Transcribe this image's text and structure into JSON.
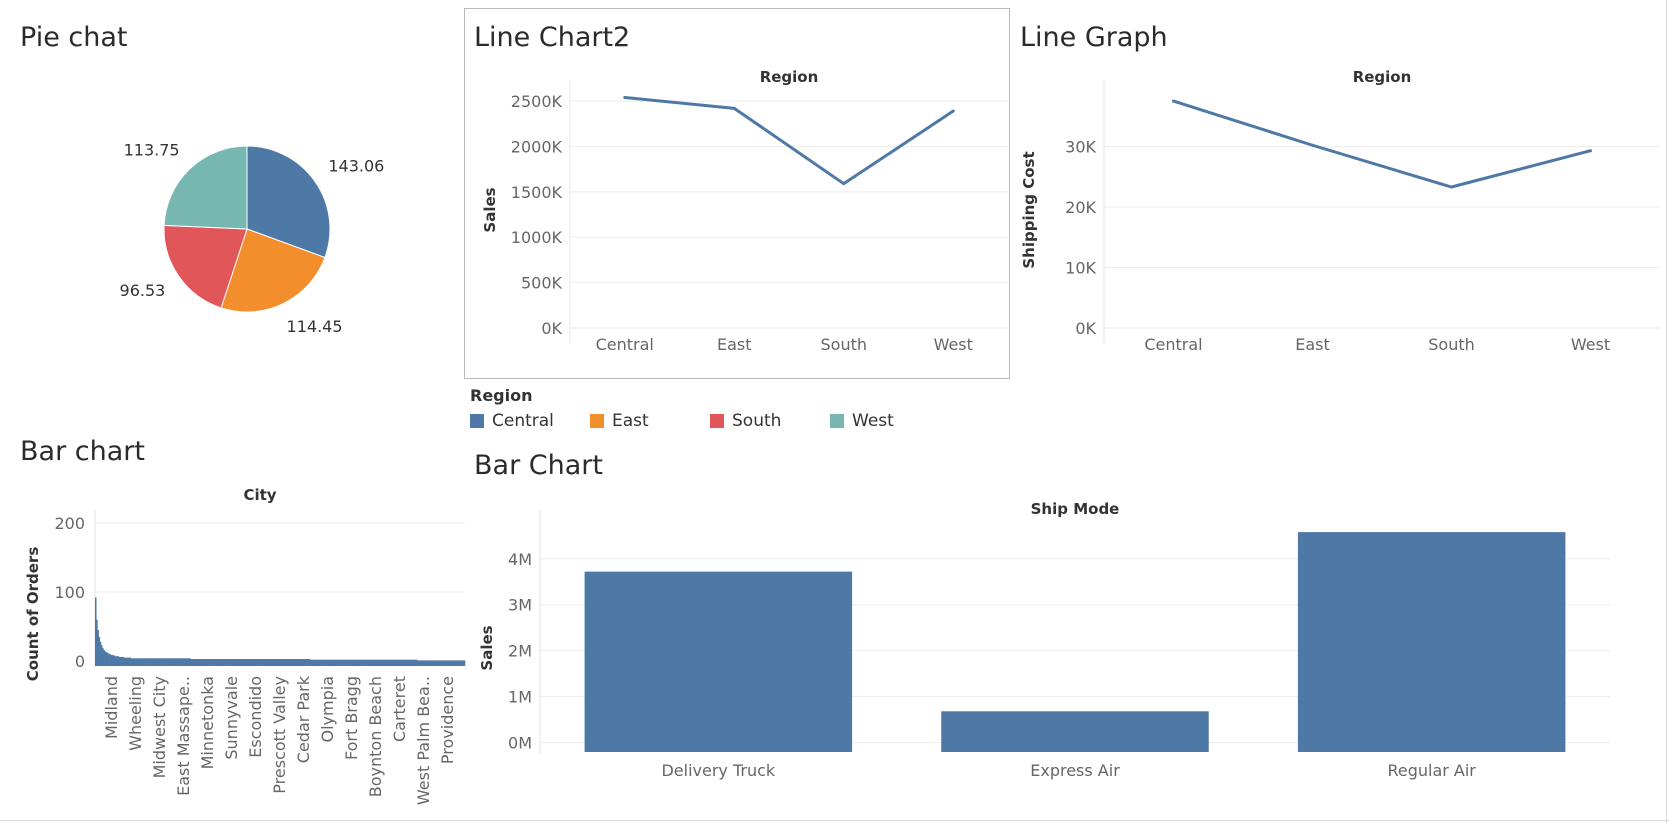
{
  "titles": {
    "pie": "Pie chat",
    "line1": "Line Chart2",
    "line2": "Line Graph",
    "bar1": "Bar chart",
    "bar2": "Bar Chart"
  },
  "colors": {
    "blue": "#4e79a7",
    "orange": "#f28e2b",
    "red": "#e15759",
    "teal": "#76b7b2"
  },
  "legend": {
    "title": "Region",
    "items": [
      {
        "label": "Central",
        "color": "#4e79a7"
      },
      {
        "label": "East",
        "color": "#f28e2b"
      },
      {
        "label": "South",
        "color": "#e15759"
      },
      {
        "label": "West",
        "color": "#76b7b2"
      }
    ]
  },
  "chart_data": [
    {
      "type": "pie",
      "slices": [
        {
          "region": "Central",
          "value": 143.06,
          "label": "143.06",
          "color": "#4e79a7"
        },
        {
          "region": "East",
          "value": 114.45,
          "label": "114.45",
          "color": "#f28e2b"
        },
        {
          "region": "South",
          "value": 96.53,
          "label": "96.53",
          "color": "#e15759"
        },
        {
          "region": "West",
          "value": 113.75,
          "label": "113.75",
          "color": "#76b7b2"
        }
      ]
    },
    {
      "type": "line",
      "header": "Region",
      "ylabel": "Sales",
      "categories": [
        "Central",
        "East",
        "South",
        "West"
      ],
      "values": [
        2540000,
        2420000,
        1590000,
        2390000
      ],
      "ylim": [
        0,
        2600000
      ],
      "yticks": [
        0,
        500000,
        1000000,
        1500000,
        2000000,
        2500000
      ],
      "ytick_labels": [
        "0K",
        "500K",
        "1000K",
        "1500K",
        "2000K",
        "2500K"
      ],
      "color": "#4e79a7"
    },
    {
      "type": "line",
      "header": "Region",
      "ylabel": "Shipping Cost",
      "categories": [
        "Central",
        "East",
        "South",
        "West"
      ],
      "values": [
        37500,
        30200,
        23300,
        29300
      ],
      "ylim": [
        0,
        39000
      ],
      "yticks": [
        0,
        10000,
        20000,
        30000
      ],
      "ytick_labels": [
        "0K",
        "10K",
        "20K",
        "30K"
      ],
      "color": "#4e79a7"
    },
    {
      "type": "bar",
      "header": "City",
      "ylabel": "Count of Orders",
      "category_labels": [
        "Midland",
        "Wheeling",
        "Midwest City",
        "East Massape..",
        "Minnetonka",
        "Sunnyvale",
        "Escondido",
        "Prescott Valley",
        "Cedar Park",
        "Olympia",
        "Fort Bragg",
        "Boynton Beach",
        "Carteret",
        "West Palm Bea..",
        "Providence"
      ],
      "values": [
        92,
        60,
        45,
        35,
        28,
        23,
        19,
        16,
        14,
        13,
        12,
        11,
        10,
        9,
        9,
        8,
        8,
        7,
        7,
        7,
        6,
        6,
        6,
        6,
        5,
        5,
        5,
        5,
        5,
        5,
        4,
        4,
        4,
        4,
        4,
        4,
        4,
        4,
        4,
        4,
        4,
        4,
        4,
        4,
        4,
        4,
        4,
        4,
        4,
        4,
        4,
        4,
        4,
        4,
        4,
        4,
        4,
        4,
        4,
        4,
        4,
        4,
        4,
        4,
        4,
        4,
        4,
        4,
        4,
        4,
        4,
        4,
        4,
        4,
        4,
        4,
        4,
        4,
        4,
        4,
        3,
        3,
        3,
        3,
        3,
        3,
        3,
        3,
        3,
        3,
        3,
        3,
        3,
        3,
        3,
        3,
        3,
        3,
        3,
        3,
        3,
        3,
        3,
        3,
        3,
        3,
        3,
        3,
        3,
        3,
        3,
        3,
        3,
        3,
        3,
        3,
        3,
        3,
        3,
        3,
        3,
        3,
        3,
        3,
        3,
        3,
        3,
        3,
        3,
        3,
        3,
        3,
        3,
        3,
        3,
        3,
        3,
        3,
        3,
        3,
        3,
        3,
        3,
        3,
        3,
        3,
        3,
        3,
        3,
        3,
        3,
        3,
        3,
        3,
        3,
        3,
        3,
        3,
        3,
        3,
        3,
        3,
        3,
        3,
        3,
        3,
        3,
        3,
        3,
        3,
        3,
        3,
        3,
        3,
        3,
        3,
        3,
        3,
        3,
        3,
        2,
        2,
        2,
        2,
        2,
        2,
        2,
        2,
        2,
        2,
        2,
        2,
        2,
        2,
        2,
        2,
        2,
        2,
        2,
        2,
        2,
        2,
        2,
        2,
        2,
        2,
        2,
        2,
        2,
        2,
        2,
        2,
        2,
        2,
        2,
        2,
        2,
        2,
        2,
        2,
        2,
        2,
        2,
        2,
        2,
        2,
        2,
        2,
        2,
        2,
        2,
        2,
        2,
        2,
        2,
        2,
        2,
        2,
        2,
        2,
        2,
        2,
        2,
        2,
        2,
        2,
        2,
        2,
        2,
        2,
        2,
        2,
        2,
        2,
        2,
        2,
        2,
        2,
        2,
        2,
        2,
        2,
        2,
        2,
        2,
        2,
        2,
        2,
        2,
        2,
        1,
        1,
        1,
        1,
        1,
        1,
        1,
        1,
        1,
        1,
        1,
        1,
        1,
        1,
        1,
        1,
        1,
        1,
        1,
        1,
        1,
        1,
        1,
        1,
        1,
        1,
        1,
        1,
        1,
        1,
        1,
        1,
        1,
        1,
        1,
        1,
        1,
        1,
        1,
        1
      ],
      "ylim": [
        -10,
        210
      ],
      "yticks": [
        0,
        100,
        200
      ],
      "ytick_labels": [
        "0",
        "100",
        "200"
      ],
      "color": "#4e79a7"
    },
    {
      "type": "bar",
      "header": "Ship Mode",
      "ylabel": "Sales",
      "categories": [
        "Delivery Truck",
        "Express Air",
        "Regular Air"
      ],
      "values": [
        3720000,
        680000,
        4580000
      ],
      "ylim": [
        -250000,
        4800000
      ],
      "yticks": [
        0,
        1000000,
        2000000,
        3000000,
        4000000
      ],
      "ytick_labels": [
        "0M",
        "1M",
        "2M",
        "3M",
        "4M"
      ],
      "color": "#4e79a7"
    }
  ]
}
